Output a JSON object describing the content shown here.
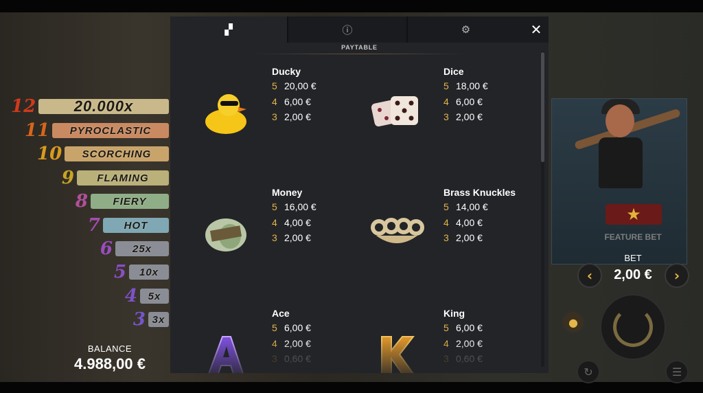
{
  "colors": {
    "accent": "#e3b54a",
    "modal_bg": "#232428",
    "tab_bg": "#1a1b1e"
  },
  "ladder": [
    {
      "num": "12",
      "label": "20.000x",
      "num_color": "#d03a1c",
      "badge_color": "#c9b98a"
    },
    {
      "num": "11",
      "label": "PYROCLASTIC",
      "num_color": "#d8661a",
      "badge_color": "#c98a62"
    },
    {
      "num": "10",
      "label": "SCORCHING",
      "num_color": "#d99a1f",
      "badge_color": "#c9a46a"
    },
    {
      "num": "9",
      "label": "FLAMING",
      "num_color": "#c9a424",
      "badge_color": "#b9b07a"
    },
    {
      "num": "8",
      "label": "FIERY",
      "num_color": "#b0509a",
      "badge_color": "#8fae88"
    },
    {
      "num": "7",
      "label": "HOT",
      "num_color": "#a44cb0",
      "badge_color": "#7fa8b4"
    },
    {
      "num": "6",
      "label": "25x",
      "num_color": "#9a4cc0",
      "badge_color": "#8a8d95"
    },
    {
      "num": "5",
      "label": "10x",
      "num_color": "#8a4ec6",
      "badge_color": "#8a8d95"
    },
    {
      "num": "4",
      "label": "5x",
      "num_color": "#7d52c8",
      "badge_color": "#8a8d95"
    },
    {
      "num": "3",
      "label": "3x",
      "num_color": "#7456c8",
      "badge_color": "#8a8d95"
    }
  ],
  "balance": {
    "label": "BALANCE",
    "value": "4.988,00 €"
  },
  "bet": {
    "label": "BET",
    "value": "2,00 €",
    "feature_label": "FEATURE BET",
    "prev": "‹",
    "next": "›"
  },
  "modal": {
    "tabs": [
      {
        "icon": "paytable-icon",
        "glyph": "▞"
      },
      {
        "icon": "info-icon",
        "glyph": "ⓘ"
      },
      {
        "icon": "settings-icon",
        "glyph": "⚙"
      }
    ],
    "close": "✕",
    "subtitle": "PAYTABLE",
    "symbols": [
      {
        "name": "Ducky",
        "icon": "duck-icon",
        "pays": [
          {
            "count": "5",
            "value": "20,00 €"
          },
          {
            "count": "4",
            "value": "6,00 €"
          },
          {
            "count": "3",
            "value": "2,00 €"
          }
        ]
      },
      {
        "name": "Dice",
        "icon": "dice-icon",
        "pays": [
          {
            "count": "5",
            "value": "18,00 €"
          },
          {
            "count": "4",
            "value": "6,00 €"
          },
          {
            "count": "3",
            "value": "2,00 €"
          }
        ]
      },
      {
        "name": "Money",
        "icon": "money-icon",
        "pays": [
          {
            "count": "5",
            "value": "16,00 €"
          },
          {
            "count": "4",
            "value": "4,00 €"
          },
          {
            "count": "3",
            "value": "2,00 €"
          }
        ]
      },
      {
        "name": "Brass Knuckles",
        "icon": "brass-knuckles-icon",
        "pays": [
          {
            "count": "5",
            "value": "14,00 €"
          },
          {
            "count": "4",
            "value": "4,00 €"
          },
          {
            "count": "3",
            "value": "2,00 €"
          }
        ]
      },
      {
        "name": "Ace",
        "icon": "ace-icon",
        "pays": [
          {
            "count": "5",
            "value": "6,00 €"
          },
          {
            "count": "4",
            "value": "2,00 €"
          },
          {
            "count": "3",
            "value": "0,60 €"
          }
        ]
      },
      {
        "name": "King",
        "icon": "king-icon",
        "pays": [
          {
            "count": "5",
            "value": "6,00 €"
          },
          {
            "count": "4",
            "value": "2,00 €"
          },
          {
            "count": "3",
            "value": "0,60 €"
          }
        ]
      }
    ]
  }
}
